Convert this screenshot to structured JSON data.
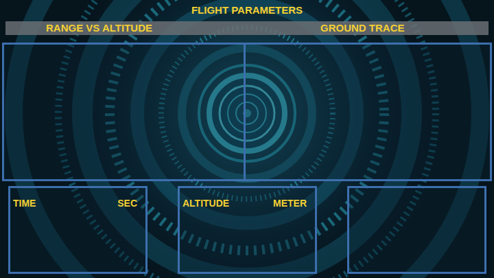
{
  "title": "FLIGHT PARAMETERS",
  "header": {
    "left": "RANGE VS ALTITUDE",
    "right": "GROUND TRACE"
  },
  "readouts": [
    {
      "label": "TIME",
      "unit": "SEC"
    },
    {
      "label": "ALTITUDE",
      "unit": "METER"
    }
  ]
}
